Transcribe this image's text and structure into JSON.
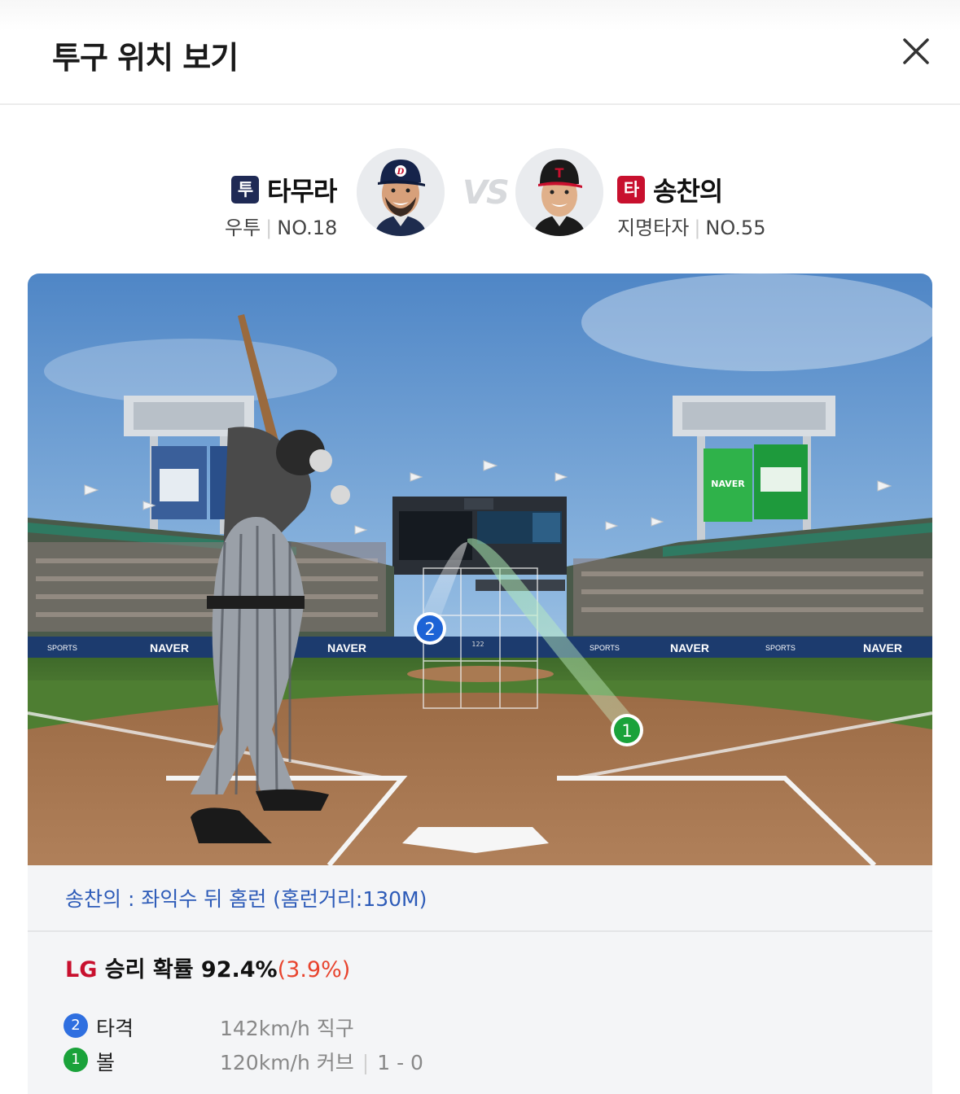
{
  "header": {
    "title": "투구 위치 보기",
    "close_icon": "close-icon"
  },
  "pitcher": {
    "badge": "투",
    "badge_color": "#1f2a55",
    "name": "타무라",
    "throws": "우투",
    "number": "NO.18"
  },
  "vs_label": "VS",
  "batter": {
    "badge": "타",
    "badge_color": "#c8102e",
    "name": "송찬의",
    "position": "지명타자",
    "number": "NO.55"
  },
  "field": {
    "ad_labels": [
      "NAVER",
      "NAVER",
      "NAVER",
      "NAVER"
    ],
    "sports_labels": [
      "SPORTS",
      "SPORTS",
      "SPORTS"
    ],
    "scoreboard_speed": "122",
    "board_label": "NAVER",
    "markers": [
      {
        "num": "2",
        "color": "#1d63d6"
      },
      {
        "num": "1",
        "color": "#1aa23a"
      }
    ]
  },
  "play_result": "송찬의 : 좌익수 뒤 홈런 (홈런거리:130M)",
  "win_probability": {
    "team": "LG",
    "text": " 승리 확률 92.4%",
    "delta": "(3.9%)"
  },
  "pitches": [
    {
      "num": "2",
      "color": "#2f6fe0",
      "label": "타격",
      "speed": "142km/h",
      "type": "직구",
      "count": ""
    },
    {
      "num": "1",
      "color": "#1aa23a",
      "label": "볼",
      "speed": "120km/h",
      "type": "커브",
      "count": "1 - 0"
    }
  ]
}
